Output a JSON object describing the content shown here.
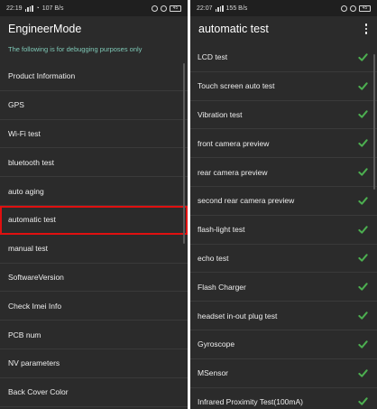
{
  "left": {
    "status": {
      "time": "22:19",
      "speed": "107 B/s",
      "battery": "45"
    },
    "title": "EngineerMode",
    "subtitle": "The following is for debugging purposes only",
    "items": [
      {
        "label": "Product Information"
      },
      {
        "label": "GPS"
      },
      {
        "label": "Wi-Fi test"
      },
      {
        "label": "bluetooth test"
      },
      {
        "label": "auto aging"
      },
      {
        "label": "automatic test",
        "highlighted": true
      },
      {
        "label": "manual test"
      },
      {
        "label": "SoftwareVersion"
      },
      {
        "label": "Check Imei Info"
      },
      {
        "label": "PCB num"
      },
      {
        "label": "NV parameters"
      },
      {
        "label": "Back Cover Color"
      }
    ]
  },
  "right": {
    "status": {
      "time": "22:07",
      "speed": "155 B/s",
      "battery": "45"
    },
    "title": "automatic test",
    "menu_icon": "more-vert-icon",
    "check_color": "#4caf50",
    "items": [
      {
        "label": "LCD test",
        "passed": true
      },
      {
        "label": "Touch screen auto test",
        "passed": true
      },
      {
        "label": "Vibration test",
        "passed": true
      },
      {
        "label": "front camera preview",
        "passed": true
      },
      {
        "label": "rear camera preview",
        "passed": true
      },
      {
        "label": "second rear camera preview",
        "passed": true
      },
      {
        "label": "flash-light test",
        "passed": true
      },
      {
        "label": "echo test",
        "passed": true
      },
      {
        "label": "Flash Charger",
        "passed": true
      },
      {
        "label": "headset in-out plug test",
        "passed": true
      },
      {
        "label": "Gyroscope",
        "passed": true
      },
      {
        "label": "MSensor",
        "passed": true
      },
      {
        "label": "Infrared Proximity Test(100mA)",
        "passed": true
      }
    ]
  }
}
